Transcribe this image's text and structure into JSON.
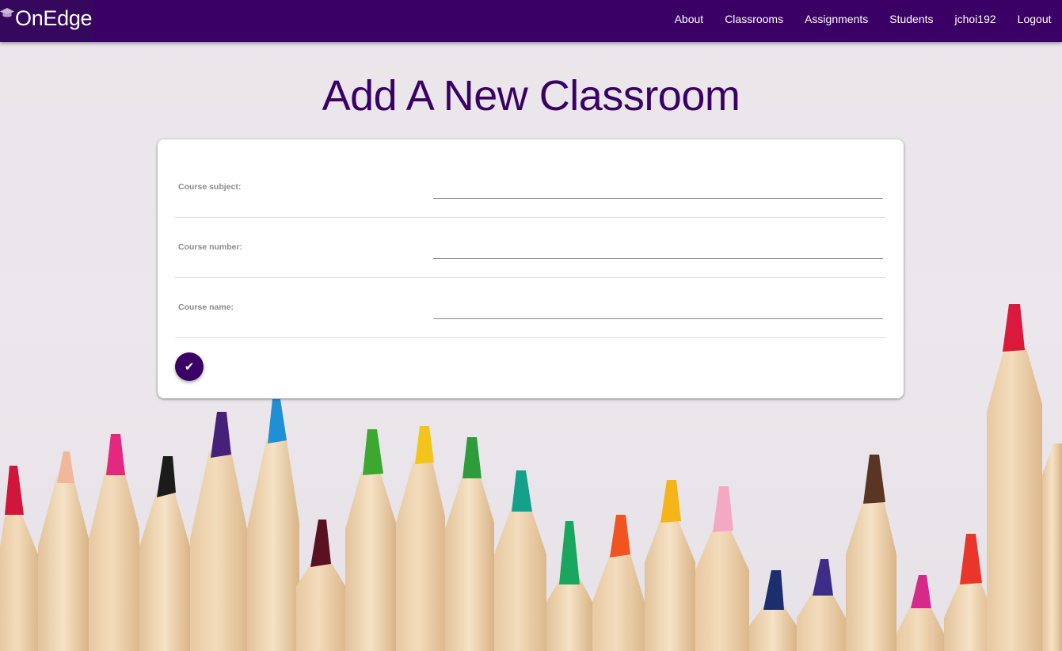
{
  "app": {
    "brand": "OnEdge",
    "brand_icon": "graduation-cap-icon"
  },
  "nav": {
    "items": [
      {
        "label": "About"
      },
      {
        "label": "Classrooms"
      },
      {
        "label": "Assignments"
      },
      {
        "label": "Students"
      },
      {
        "label": "jchoi192"
      },
      {
        "label": "Logout"
      }
    ]
  },
  "page": {
    "title": "Add A New Classroom"
  },
  "form": {
    "fields": [
      {
        "label": "Course subject:",
        "value": ""
      },
      {
        "label": "Course number:",
        "value": ""
      },
      {
        "label": "Course name:",
        "value": ""
      }
    ],
    "submit_icon": "checkmark-icon",
    "submit_glyph": "✔"
  },
  "colors": {
    "brand_purple": "#3a0066",
    "background": "#e9e5ea",
    "card": "#ffffff"
  }
}
